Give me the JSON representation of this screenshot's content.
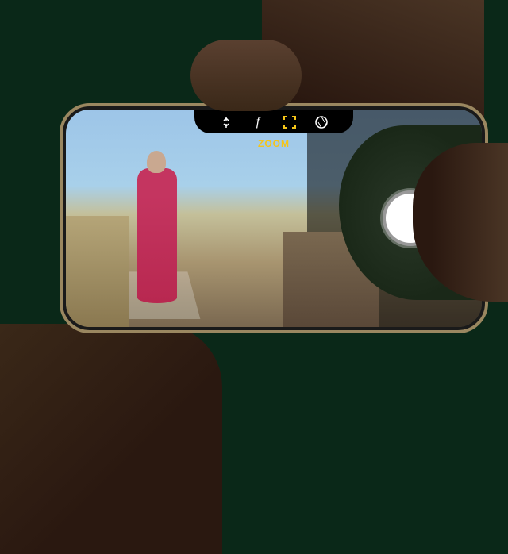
{
  "camera": {
    "zoom_label": "ZOOM",
    "icons": {
      "exposure": "exposure-icon",
      "f_stop": "f",
      "focus": "focus-frame-icon",
      "shutter_settings": "aperture-icon"
    },
    "focus_active_color": "#f5c518"
  }
}
